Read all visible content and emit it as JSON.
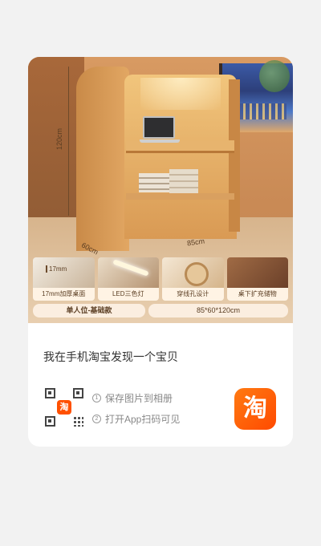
{
  "share_card": {
    "features": [
      {
        "label": "17mm加厚桌面"
      },
      {
        "label": "LED三色灯"
      },
      {
        "label": "穿线孔设计"
      },
      {
        "label": "桌下扩充储物"
      }
    ],
    "dimensions": {
      "height": "120cm",
      "width": "60cm",
      "depth": "85cm"
    },
    "variant": "单人位-基础款",
    "size": "85*60*120cm",
    "caption": "我在手机淘宝发现一个宝贝",
    "steps": [
      {
        "num": "1",
        "text": "保存图片到相册"
      },
      {
        "num": "2",
        "text": "打开App扫码可见"
      }
    ],
    "qr_logo": "淘",
    "app_icon": "淘"
  }
}
